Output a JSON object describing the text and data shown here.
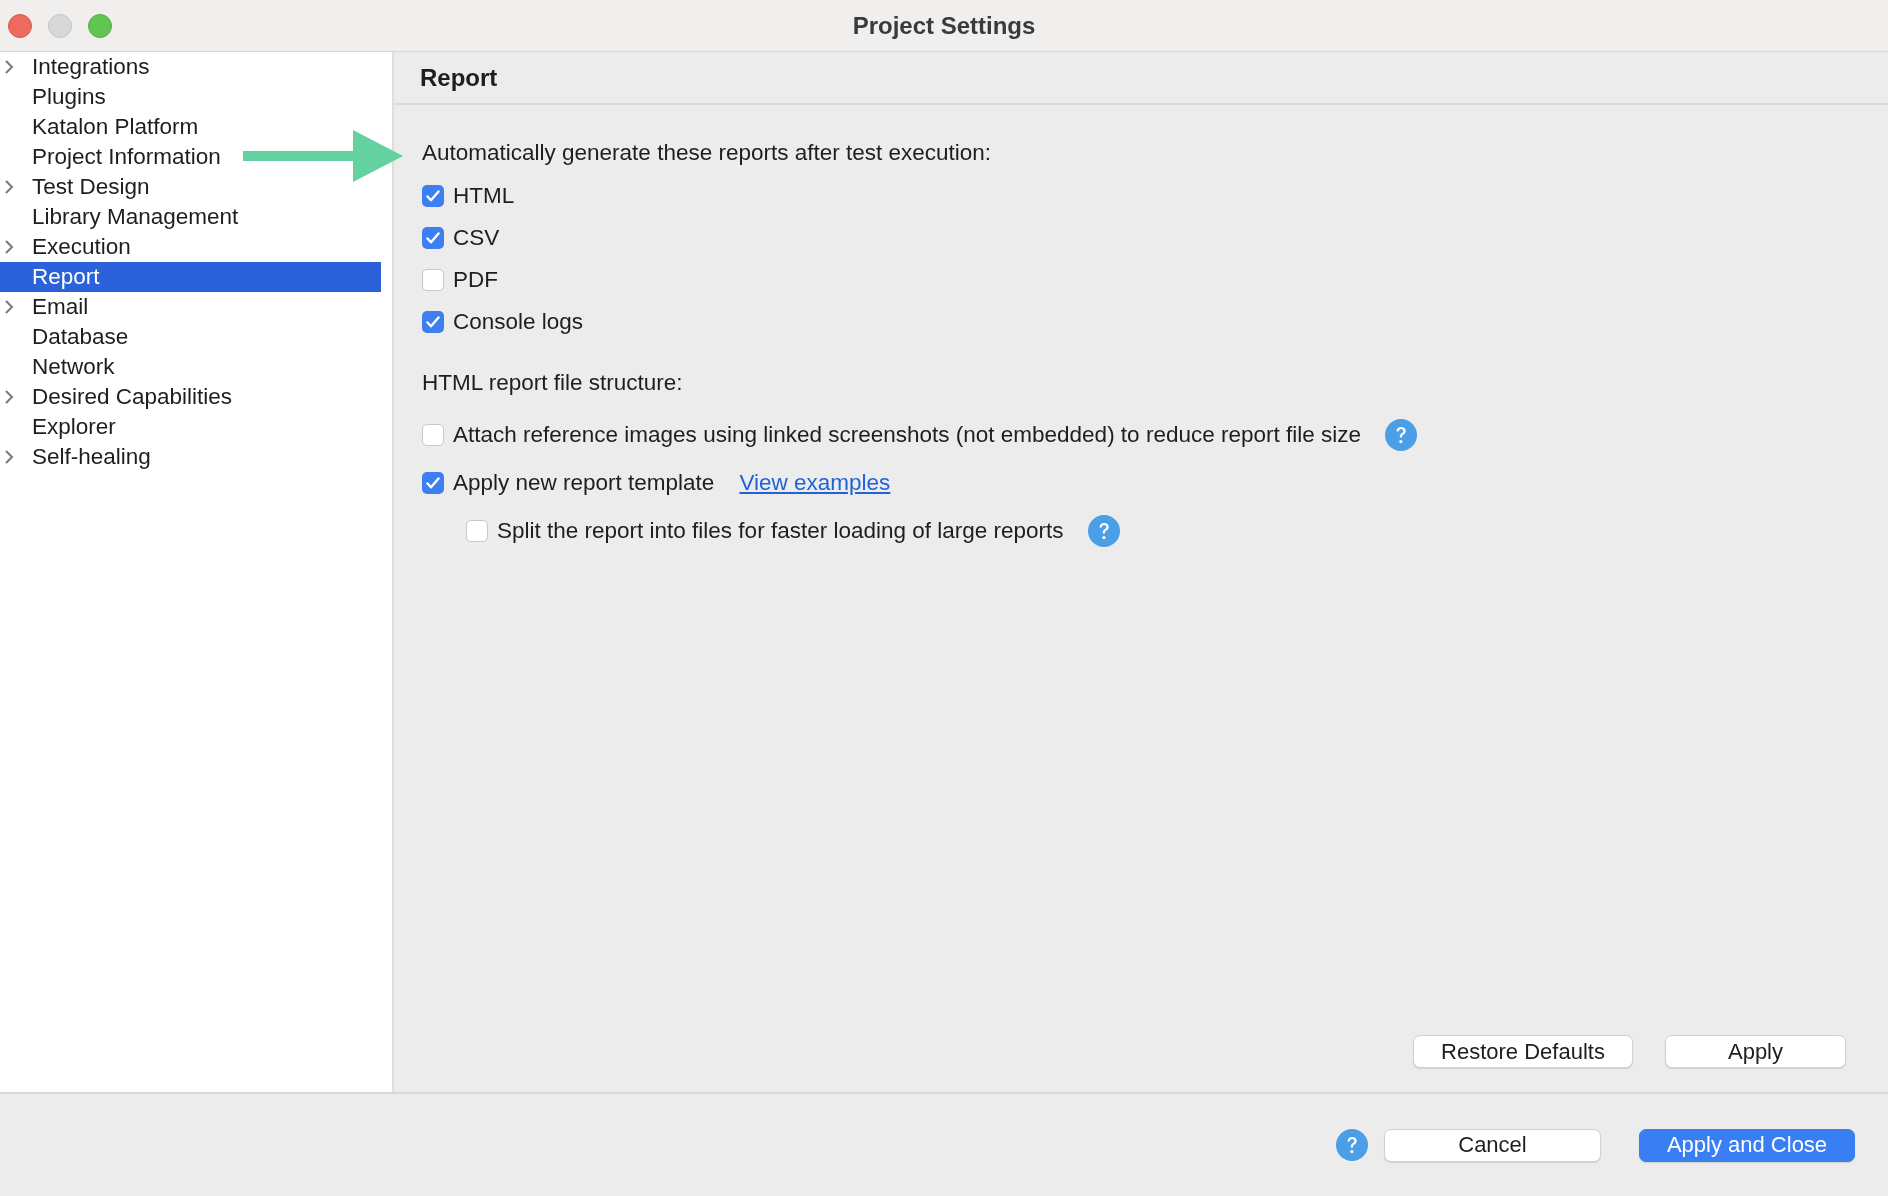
{
  "window": {
    "title": "Project Settings"
  },
  "sidebar": {
    "items": [
      {
        "label": "Integrations",
        "expandable": true,
        "selected": false
      },
      {
        "label": "Plugins",
        "expandable": false,
        "selected": false
      },
      {
        "label": "Katalon Platform",
        "expandable": false,
        "selected": false
      },
      {
        "label": "Project Information",
        "expandable": false,
        "selected": false
      },
      {
        "label": "Test Design",
        "expandable": true,
        "selected": false
      },
      {
        "label": "Library Management",
        "expandable": false,
        "selected": false
      },
      {
        "label": "Execution",
        "expandable": true,
        "selected": false
      },
      {
        "label": "Report",
        "expandable": false,
        "selected": true
      },
      {
        "label": "Email",
        "expandable": true,
        "selected": false
      },
      {
        "label": "Database",
        "expandable": false,
        "selected": false
      },
      {
        "label": "Network",
        "expandable": false,
        "selected": false
      },
      {
        "label": "Desired Capabilities",
        "expandable": true,
        "selected": false
      },
      {
        "label": "Explorer",
        "expandable": false,
        "selected": false
      },
      {
        "label": "Self-healing",
        "expandable": true,
        "selected": false
      }
    ]
  },
  "page": {
    "title": "Report",
    "generate_label": "Automatically generate these reports after test execution:",
    "reports": [
      {
        "label": "HTML",
        "checked": true
      },
      {
        "label": "CSV",
        "checked": true
      },
      {
        "label": "PDF",
        "checked": false
      },
      {
        "label": "Console logs",
        "checked": true
      }
    ],
    "structure_label": "HTML report file structure:",
    "structure_options": [
      {
        "label": "Attach reference images using linked screenshots (not embedded) to reduce report file size",
        "checked": false,
        "help": true
      },
      {
        "label": "Apply new report template",
        "checked": true,
        "help": false,
        "link": "View examples",
        "children": [
          {
            "label": "Split the report into files for faster loading of large reports",
            "checked": false,
            "help": true
          }
        ]
      }
    ],
    "buttons": [
      {
        "label": "Restore Defaults"
      },
      {
        "label": "Apply"
      }
    ]
  },
  "footer": {
    "help": true,
    "buttons": [
      {
        "label": "Cancel",
        "primary": false
      },
      {
        "label": "Apply and Close",
        "primary": true
      }
    ]
  }
}
